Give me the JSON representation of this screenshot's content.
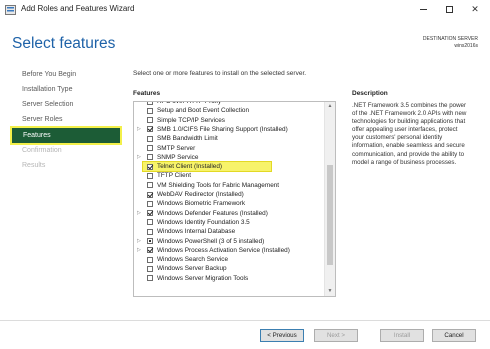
{
  "window": {
    "title": "Add Roles and Features Wizard",
    "min_label": "—",
    "close_label": "✕"
  },
  "header": {
    "page_title": "Select features",
    "destination_label": "DESTINATION SERVER",
    "destination_server": "wins2016s"
  },
  "nav": {
    "items": [
      {
        "label": "Before You Begin",
        "state": "normal"
      },
      {
        "label": "Installation Type",
        "state": "normal"
      },
      {
        "label": "Server Selection",
        "state": "normal"
      },
      {
        "label": "Server Roles",
        "state": "normal"
      },
      {
        "label": "Features",
        "state": "active"
      },
      {
        "label": "Confirmation",
        "state": "disabled"
      },
      {
        "label": "Results",
        "state": "disabled"
      }
    ]
  },
  "main": {
    "instruction": "Select one or more features to install on the selected server.",
    "features_label": "Features",
    "description_label": "Description",
    "description_text": ".NET Framework 3.5 combines the power of the .NET Framework 2.0 APIs with new technologies for building applications that offer appealing user interfaces, protect your customers' personal identity information, enable seamless and secure communication, and provide the ability to model a range of business processes.",
    "features": [
      {
        "label": "RPC over HTTP Proxy",
        "checked": "none",
        "expander": false
      },
      {
        "label": "Setup and Boot Event Collection",
        "checked": "none",
        "expander": false
      },
      {
        "label": "Simple TCP/IP Services",
        "checked": "none",
        "expander": false
      },
      {
        "label": "SMB 1.0/CIFS File Sharing Support (Installed)",
        "checked": "checked",
        "expander": true
      },
      {
        "label": "SMB Bandwidth Limit",
        "checked": "none",
        "expander": false
      },
      {
        "label": "SMTP Server",
        "checked": "none",
        "expander": false
      },
      {
        "label": "SNMP Service",
        "checked": "none",
        "expander": true
      },
      {
        "label": "Telnet Client (Installed)",
        "checked": "checked",
        "expander": false,
        "highlight": true
      },
      {
        "label": "TFTP Client",
        "checked": "none",
        "expander": false
      },
      {
        "label": "VM Shielding Tools for Fabric Management",
        "checked": "none",
        "expander": false
      },
      {
        "label": "WebDAV Redirector (Installed)",
        "checked": "checked",
        "expander": false
      },
      {
        "label": "Windows Biometric Framework",
        "checked": "none",
        "expander": false
      },
      {
        "label": "Windows Defender Features (Installed)",
        "checked": "checked",
        "expander": true
      },
      {
        "label": "Windows Identity Foundation 3.5",
        "checked": "none",
        "expander": false
      },
      {
        "label": "Windows Internal Database",
        "checked": "none",
        "expander": false
      },
      {
        "label": "Windows PowerShell (3 of 5 installed)",
        "checked": "partial",
        "expander": true
      },
      {
        "label": "Windows Process Activation Service (Installed)",
        "checked": "checked",
        "expander": true
      },
      {
        "label": "Windows Search Service",
        "checked": "none",
        "expander": false
      },
      {
        "label": "Windows Server Backup",
        "checked": "none",
        "expander": false
      },
      {
        "label": "Windows Server Migration Tools",
        "checked": "none",
        "expander": false
      }
    ]
  },
  "footer": {
    "previous_label": "< Previous",
    "next_label": "Next >",
    "install_label": "Install",
    "cancel_label": "Cancel"
  },
  "colors": {
    "title_blue": "#1e62a8",
    "nav_active_bg": "#1c5c36",
    "highlight_yellow": "#f7f36a"
  }
}
